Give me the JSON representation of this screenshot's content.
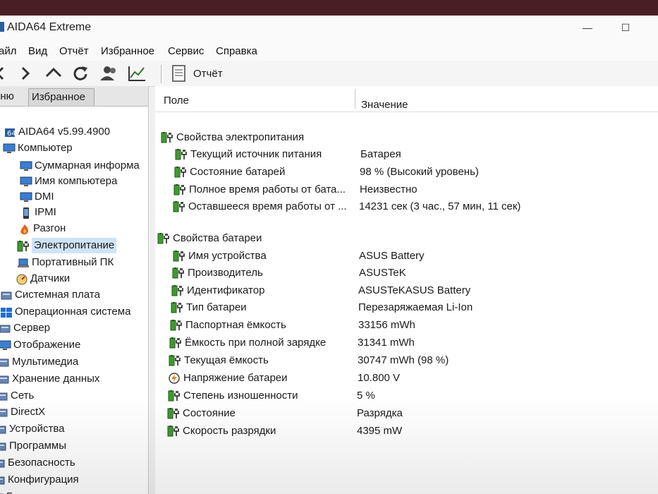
{
  "window": {
    "title": "AIDA64 Extreme",
    "minimize": "—",
    "maximize": "☐"
  },
  "menu": [
    "айл",
    "Вид",
    "Отчёт",
    "Избранное",
    "Сервис",
    "Справка"
  ],
  "toolbar": {
    "report_label": "Отчёт"
  },
  "tabs": {
    "menu_tab": "еню",
    "favorites_tab": "Избранное"
  },
  "tree": [
    {
      "label": "AIDA64 v5.99.4900",
      "icon": "app-icon"
    },
    {
      "label": "Компьютер",
      "icon": "computer-icon"
    },
    {
      "label": "Суммарная информа",
      "icon": "monitor-icon"
    },
    {
      "label": "Имя компьютера",
      "icon": "monitor-icon"
    },
    {
      "label": "DMI",
      "icon": "monitor-icon"
    },
    {
      "label": "IPMI",
      "icon": "phone-icon"
    },
    {
      "label": "Разгон",
      "icon": "fire-icon"
    },
    {
      "label": "Электропитание",
      "icon": "battery-plug-icon"
    },
    {
      "label": "Портативный ПК",
      "icon": "laptop-icon"
    },
    {
      "label": "Датчики",
      "icon": "gauge-icon"
    },
    {
      "label": "Системная плата",
      "icon": "motherboard-icon"
    },
    {
      "label": "Операционная система",
      "icon": "windows-icon"
    },
    {
      "label": "Сервер",
      "icon": "server-icon"
    },
    {
      "label": "Отображение",
      "icon": "display-icon"
    },
    {
      "label": "Мультимедиа",
      "icon": "multimedia-icon"
    },
    {
      "label": "Хранение данных",
      "icon": "storage-icon"
    },
    {
      "label": "Сеть",
      "icon": "network-icon"
    },
    {
      "label": "DirectX",
      "icon": "directx-icon"
    },
    {
      "label": "Устройства",
      "icon": "devices-icon"
    },
    {
      "label": "Программы",
      "icon": "programs-icon"
    },
    {
      "label": "Безопасность",
      "icon": "security-icon"
    },
    {
      "label": "Конфигурация",
      "icon": "config-icon"
    },
    {
      "label": "База данных",
      "icon": "database-icon"
    }
  ],
  "columns": {
    "field": "Поле",
    "value": "Значение"
  },
  "sections": [
    {
      "title": "Свойства электропитания",
      "rows": [
        {
          "field": "Текущий источник питания",
          "value": "Батарея",
          "icon": "battery-plug-icon"
        },
        {
          "field": "Состояние батарей",
          "value": "98 % (Высокий уровень)",
          "icon": "battery-plug-icon"
        },
        {
          "field": "Полное время работы от бата...",
          "value": "Неизвестно",
          "icon": "battery-plug-icon"
        },
        {
          "field": "Оставшееся время работы от ...",
          "value": "14231 сек (3 час., 57 мин, 11 сек)",
          "icon": "battery-plug-icon"
        }
      ]
    },
    {
      "title": "Свойства батареи",
      "rows": [
        {
          "field": "Имя устройства",
          "value": "ASUS Battery",
          "icon": "battery-plug-icon"
        },
        {
          "field": "Производитель",
          "value": "ASUSTeK",
          "icon": "battery-plug-icon"
        },
        {
          "field": "Идентификатор",
          "value": "ASUSTeKASUS Battery",
          "icon": "battery-plug-icon"
        },
        {
          "field": "Тип батареи",
          "value": "Перезаряжаемая Li-Ion",
          "icon": "battery-plug-icon"
        },
        {
          "field": "Паспортная ёмкость",
          "value": "33156 mWh",
          "icon": "battery-plug-icon"
        },
        {
          "field": "Ёмкость при полной зарядке",
          "value": "31341 mWh",
          "icon": "battery-plug-icon"
        },
        {
          "field": "Текущая ёмкость",
          "value": "30747 mWh  (98 %)",
          "icon": "battery-plug-icon"
        },
        {
          "field": "Напряжение батареи",
          "value": "10.800 V",
          "icon": "voltage-icon"
        },
        {
          "field": "Степень изношенности",
          "value": "5 %",
          "icon": "battery-plug-icon"
        },
        {
          "field": "Состояние",
          "value": "Разрядка",
          "icon": "battery-plug-icon"
        },
        {
          "field": "Скорость разрядки",
          "value": "4395 mW",
          "icon": "battery-plug-icon"
        }
      ]
    }
  ]
}
